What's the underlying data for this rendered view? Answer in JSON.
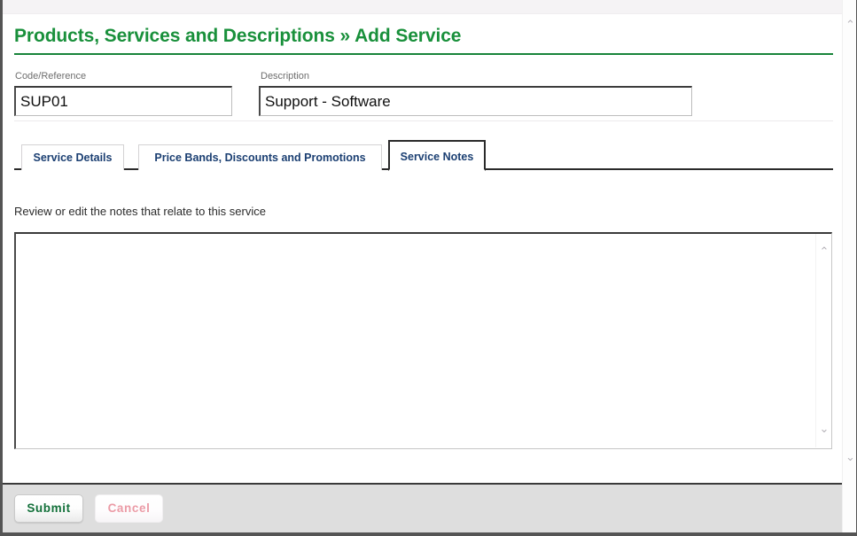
{
  "window": {
    "frame_color": "#545454",
    "background": "#ffffff"
  },
  "header": {
    "title": "Products, Services and Descriptions » Add Service",
    "title_color": "#19903b",
    "rule_color": "#18843a"
  },
  "fields": [
    {
      "label": "Code/Reference",
      "value": "SUP01",
      "placeholder": ""
    },
    {
      "label": "Description",
      "value": "Support - Software",
      "placeholder": ""
    }
  ],
  "tabs": {
    "active_index": 2,
    "items": [
      {
        "label": "Service Details",
        "active": false
      },
      {
        "label": "Price Bands, Discounts and Promotions",
        "active": false
      },
      {
        "label": "Service Notes",
        "active": true
      }
    ],
    "text_color": "#1b3f72"
  },
  "notes_panel": {
    "helper_text": "Review or edit the notes that relate to this service",
    "notes_value": "",
    "notes_placeholder": ""
  },
  "scrollbars": {
    "notes_up_icon": "chevron-up-icon",
    "notes_down_icon": "chevron-down-icon",
    "page_up_icon": "chevron-up-icon",
    "page_down_icon": "chevron-down-icon",
    "up_glyph": "⌃",
    "down_glyph": "⌄"
  },
  "footer": {
    "background": "#dedede",
    "buttons": [
      {
        "label": "Submit",
        "color": "#13703a",
        "enabled": true
      },
      {
        "label": "Cancel",
        "color": "#eb9ba6",
        "enabled": false
      }
    ]
  }
}
